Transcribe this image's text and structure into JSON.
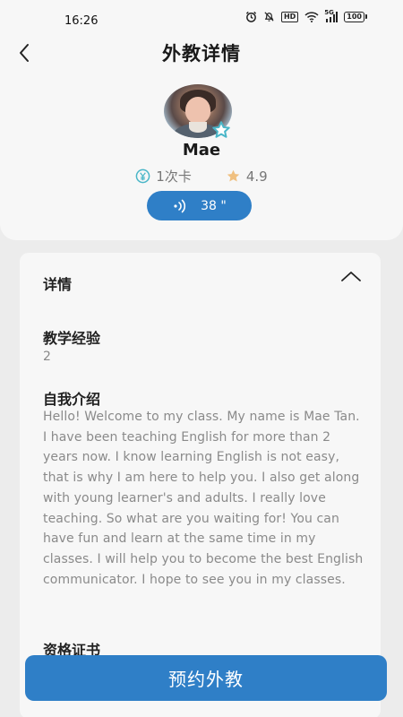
{
  "status_bar": {
    "time": "16:26",
    "network": "5G",
    "hd": "HD",
    "battery": "100"
  },
  "header": {
    "title": "外教详情"
  },
  "teacher": {
    "name": "Mae",
    "card_label": "1次卡",
    "rating": "4.9",
    "audio_duration": "38 \""
  },
  "details": {
    "header": "详情",
    "experience_title": "教学经验",
    "experience_value": "2",
    "intro_title": "自我介绍",
    "intro_text": "Hello! Welcome to my class. My name is Mae Tan. I have been teaching English for more than 2 years now. I know learning English is not easy, that is why I am here to help you. I also get along with young learner's and adults. I really love teaching. So what are you waiting for! You can have fun and learn at the same time in my classes. I will help you to become the best English communicator. I hope to see you in my classes.",
    "certificate_title": "资格证书"
  },
  "actions": {
    "book_label": "预约外教"
  },
  "colors": {
    "accent": "#2f7fc7",
    "star": "#f0c080",
    "badge_teal": "#4ab6c8"
  }
}
